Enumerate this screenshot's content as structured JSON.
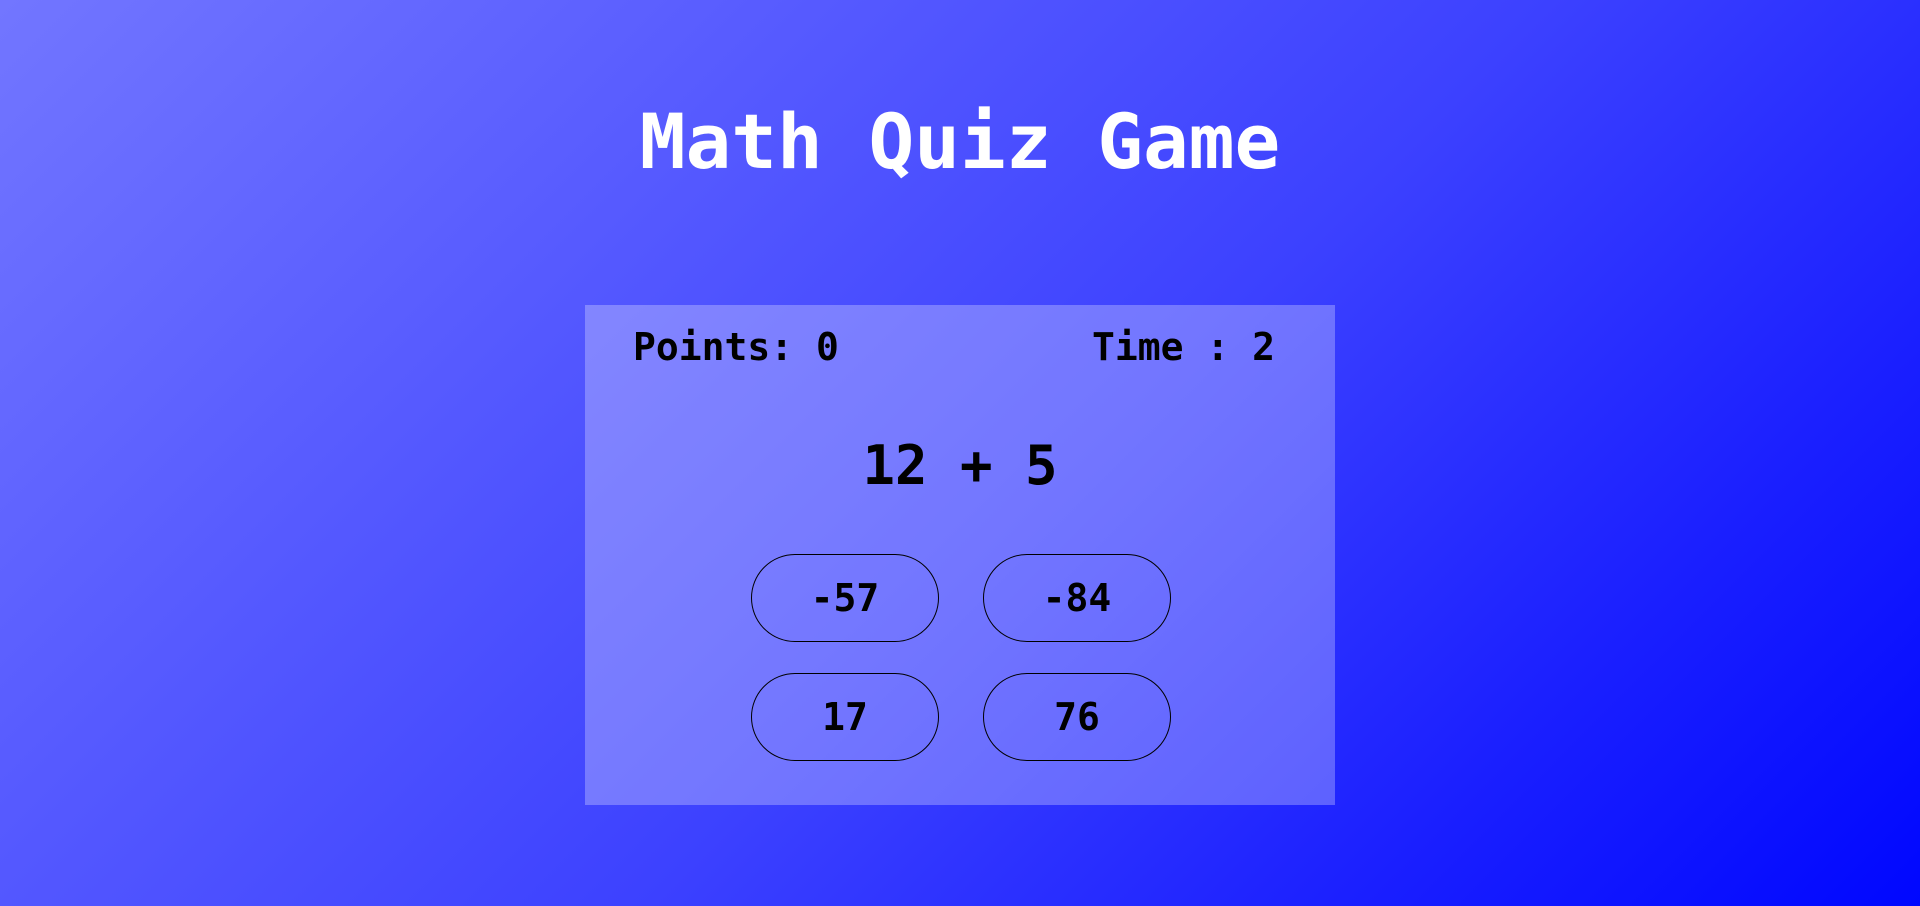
{
  "game": {
    "title": "Math Quiz Game",
    "points_text": "Points: 0",
    "time_text": "Time : 2",
    "question": "12 + 5",
    "answers": [
      "-57",
      "-84",
      "17",
      "76"
    ]
  },
  "colors": {
    "background_start": "#7276ff",
    "background_end": "#0007ff",
    "title": "#ffffff",
    "text": "#000000"
  }
}
